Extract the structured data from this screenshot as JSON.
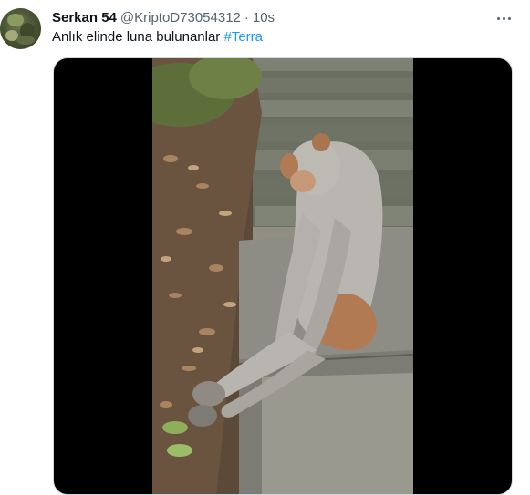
{
  "tweet": {
    "author": {
      "display_name": "Serkan 54",
      "handle": "@KriptoD73054312"
    },
    "separator": "·",
    "timestamp": "10s",
    "text": "Anlık elinde luna bulunanlar",
    "hashtag": "#Terra",
    "more_icon": "more-horizontal-icon",
    "media": {
      "type": "video",
      "subject": "monkey"
    }
  },
  "colors": {
    "link": "#1d9bf0",
    "secondary_text": "#536471",
    "primary_text": "#0f1419",
    "media_background": "#000000"
  }
}
